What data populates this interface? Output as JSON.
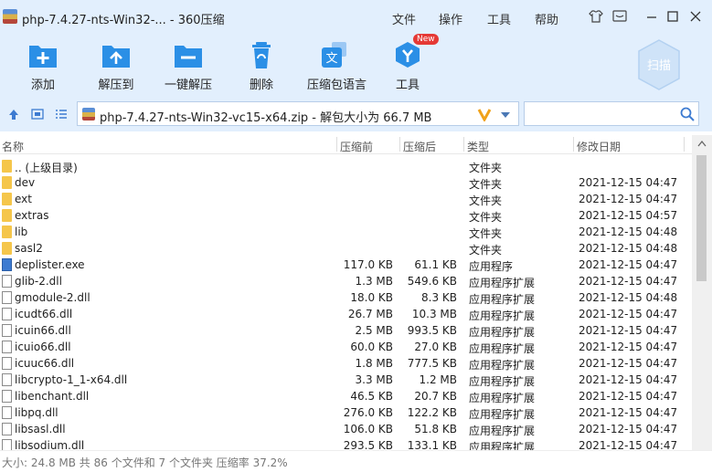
{
  "window": {
    "title": "php-7.4.27-nts-Win32-... - 360压缩",
    "menu": [
      "文件",
      "操作",
      "工具",
      "帮助"
    ]
  },
  "toolbar": {
    "items": [
      {
        "label": "添加",
        "icon": "add-icon"
      },
      {
        "label": "解压到",
        "icon": "extract-to-icon"
      },
      {
        "label": "一键解压",
        "icon": "one-click-extract-icon"
      },
      {
        "label": "删除",
        "icon": "delete-icon"
      },
      {
        "label": "压缩包语言",
        "icon": "archive-language-icon"
      },
      {
        "label": "工具",
        "icon": "tools-icon"
      }
    ],
    "new_badge": "New",
    "scan_label": "扫描"
  },
  "address": {
    "path": "php-7.4.27-nts-Win32-vc15-x64.zip - 解包大小为 66.7 MB",
    "search_placeholder": ""
  },
  "columns": [
    "名称",
    "压缩前",
    "压缩后",
    "类型",
    "修改日期"
  ],
  "files": [
    {
      "name": ".. (上级目录)",
      "orig": "",
      "comp": "",
      "type": "文件夹",
      "date": "",
      "kind": "folder"
    },
    {
      "name": "dev",
      "orig": "",
      "comp": "",
      "type": "文件夹",
      "date": "2021-12-15 04:47",
      "kind": "folder"
    },
    {
      "name": "ext",
      "orig": "",
      "comp": "",
      "type": "文件夹",
      "date": "2021-12-15 04:47",
      "kind": "folder"
    },
    {
      "name": "extras",
      "orig": "",
      "comp": "",
      "type": "文件夹",
      "date": "2021-12-15 04:57",
      "kind": "folder"
    },
    {
      "name": "lib",
      "orig": "",
      "comp": "",
      "type": "文件夹",
      "date": "2021-12-15 04:48",
      "kind": "folder"
    },
    {
      "name": "sasl2",
      "orig": "",
      "comp": "",
      "type": "文件夹",
      "date": "2021-12-15 04:48",
      "kind": "folder"
    },
    {
      "name": "deplister.exe",
      "orig": "117.0 KB",
      "comp": "61.1 KB",
      "type": "应用程序",
      "date": "2021-12-15 04:47",
      "kind": "exe"
    },
    {
      "name": "glib-2.dll",
      "orig": "1.3 MB",
      "comp": "549.6 KB",
      "type": "应用程序扩展",
      "date": "2021-12-15 04:47",
      "kind": "file"
    },
    {
      "name": "gmodule-2.dll",
      "orig": "18.0 KB",
      "comp": "8.3 KB",
      "type": "应用程序扩展",
      "date": "2021-12-15 04:48",
      "kind": "file"
    },
    {
      "name": "icudt66.dll",
      "orig": "26.7 MB",
      "comp": "10.3 MB",
      "type": "应用程序扩展",
      "date": "2021-12-15 04:47",
      "kind": "file"
    },
    {
      "name": "icuin66.dll",
      "orig": "2.5 MB",
      "comp": "993.5 KB",
      "type": "应用程序扩展",
      "date": "2021-12-15 04:47",
      "kind": "file"
    },
    {
      "name": "icuio66.dll",
      "orig": "60.0 KB",
      "comp": "27.0 KB",
      "type": "应用程序扩展",
      "date": "2021-12-15 04:47",
      "kind": "file"
    },
    {
      "name": "icuuc66.dll",
      "orig": "1.8 MB",
      "comp": "777.5 KB",
      "type": "应用程序扩展",
      "date": "2021-12-15 04:47",
      "kind": "file"
    },
    {
      "name": "libcrypto-1_1-x64.dll",
      "orig": "3.3 MB",
      "comp": "1.2 MB",
      "type": "应用程序扩展",
      "date": "2021-12-15 04:47",
      "kind": "file"
    },
    {
      "name": "libenchant.dll",
      "orig": "46.5 KB",
      "comp": "20.7 KB",
      "type": "应用程序扩展",
      "date": "2021-12-15 04:47",
      "kind": "file"
    },
    {
      "name": "libpq.dll",
      "orig": "276.0 KB",
      "comp": "122.2 KB",
      "type": "应用程序扩展",
      "date": "2021-12-15 04:47",
      "kind": "file"
    },
    {
      "name": "libsasl.dll",
      "orig": "106.0 KB",
      "comp": "51.8 KB",
      "type": "应用程序扩展",
      "date": "2021-12-15 04:47",
      "kind": "file"
    },
    {
      "name": "libsodium.dll",
      "orig": "293.5 KB",
      "comp": "133.1 KB",
      "type": "应用程序扩展",
      "date": "2021-12-15 04:47",
      "kind": "file"
    }
  ],
  "status": "大小: 24.8 MB 共 86 个文件和 7 个文件夹 压缩率 37.2%",
  "colors": {
    "chrome": "#e2effd",
    "accent": "#2b8fe6",
    "folder": "#f5c64b"
  }
}
